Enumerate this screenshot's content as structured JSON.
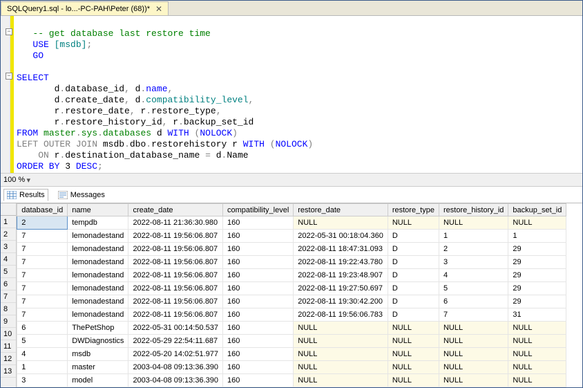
{
  "tab": {
    "title": "SQLQuery1.sql - lo...-PC-PAH\\Peter (68))*",
    "close": "✕"
  },
  "zoom": "100 %",
  "resultsTabs": {
    "results": "Results",
    "messages": "Messages"
  },
  "sql": {
    "comment": "-- get database last restore time",
    "use": "USE",
    "msdb": "[msdb]",
    "go": "GO",
    "select": "SELECT",
    "l1": "    d",
    "dot": ".",
    "database_id": "database_id",
    "cma": ", ",
    "d2": "d",
    "name": "name",
    "l2a": "    d",
    "create_date": "create_date",
    "compatibility_level": "compatibility_level",
    "l3a": "    r",
    "restore_date": "restore_date",
    "restore_type": "restore_type",
    "l4a": "    r",
    "restore_history_id": "restore_history_id",
    "backup_set_id": "backup_set_id",
    "r2": "r",
    "from": "FROM",
    "master": "master",
    "sys": "sys",
    "databases": "databases",
    "d": " d ",
    "with": "WITH",
    "nolock": "NOLOCK",
    "loj": "LEFT OUTER JOIN",
    "msdb2": "msdb",
    "dbo": "dbo",
    "rh": "restorehistory",
    "r": " r ",
    "on": "ON",
    "ddn": "destination_database_name",
    "eq": " = ",
    "dname": "Name",
    "orderby": "ORDER BY",
    "three": " 3 ",
    "desc": "DESC",
    "semi": ";",
    "op": "(",
    "cp": ")",
    "sp": " "
  },
  "columns": [
    "database_id",
    "name",
    "create_date",
    "compatibility_level",
    "restore_date",
    "restore_type",
    "restore_history_id",
    "backup_set_id"
  ],
  "rows": [
    {
      "n": 1,
      "database_id": "2",
      "name": "tempdb",
      "create_date": "2022-08-11 21:36:30.980",
      "compatibility_level": "160",
      "restore_date": "NULL",
      "restore_type": "NULL",
      "restore_history_id": "NULL",
      "backup_set_id": "NULL"
    },
    {
      "n": 2,
      "database_id": "7",
      "name": "lemonadestand",
      "create_date": "2022-08-11 19:56:06.807",
      "compatibility_level": "160",
      "restore_date": "2022-05-31 00:18:04.360",
      "restore_type": "D",
      "restore_history_id": "1",
      "backup_set_id": "1"
    },
    {
      "n": 3,
      "database_id": "7",
      "name": "lemonadestand",
      "create_date": "2022-08-11 19:56:06.807",
      "compatibility_level": "160",
      "restore_date": "2022-08-11 18:47:31.093",
      "restore_type": "D",
      "restore_history_id": "2",
      "backup_set_id": "29"
    },
    {
      "n": 4,
      "database_id": "7",
      "name": "lemonadestand",
      "create_date": "2022-08-11 19:56:06.807",
      "compatibility_level": "160",
      "restore_date": "2022-08-11 19:22:43.780",
      "restore_type": "D",
      "restore_history_id": "3",
      "backup_set_id": "29"
    },
    {
      "n": 5,
      "database_id": "7",
      "name": "lemonadestand",
      "create_date": "2022-08-11 19:56:06.807",
      "compatibility_level": "160",
      "restore_date": "2022-08-11 19:23:48.907",
      "restore_type": "D",
      "restore_history_id": "4",
      "backup_set_id": "29"
    },
    {
      "n": 6,
      "database_id": "7",
      "name": "lemonadestand",
      "create_date": "2022-08-11 19:56:06.807",
      "compatibility_level": "160",
      "restore_date": "2022-08-11 19:27:50.697",
      "restore_type": "D",
      "restore_history_id": "5",
      "backup_set_id": "29"
    },
    {
      "n": 7,
      "database_id": "7",
      "name": "lemonadestand",
      "create_date": "2022-08-11 19:56:06.807",
      "compatibility_level": "160",
      "restore_date": "2022-08-11 19:30:42.200",
      "restore_type": "D",
      "restore_history_id": "6",
      "backup_set_id": "29"
    },
    {
      "n": 8,
      "database_id": "7",
      "name": "lemonadestand",
      "create_date": "2022-08-11 19:56:06.807",
      "compatibility_level": "160",
      "restore_date": "2022-08-11 19:56:06.783",
      "restore_type": "D",
      "restore_history_id": "7",
      "backup_set_id": "31"
    },
    {
      "n": 9,
      "database_id": "6",
      "name": "ThePetShop",
      "create_date": "2022-05-31 00:14:50.537",
      "compatibility_level": "160",
      "restore_date": "NULL",
      "restore_type": "NULL",
      "restore_history_id": "NULL",
      "backup_set_id": "NULL"
    },
    {
      "n": 10,
      "database_id": "5",
      "name": "DWDiagnostics",
      "create_date": "2022-05-29 22:54:11.687",
      "compatibility_level": "160",
      "restore_date": "NULL",
      "restore_type": "NULL",
      "restore_history_id": "NULL",
      "backup_set_id": "NULL"
    },
    {
      "n": 11,
      "database_id": "4",
      "name": "msdb",
      "create_date": "2022-05-20 14:02:51.977",
      "compatibility_level": "160",
      "restore_date": "NULL",
      "restore_type": "NULL",
      "restore_history_id": "NULL",
      "backup_set_id": "NULL"
    },
    {
      "n": 12,
      "database_id": "1",
      "name": "master",
      "create_date": "2003-04-08 09:13:36.390",
      "compatibility_level": "160",
      "restore_date": "NULL",
      "restore_type": "NULL",
      "restore_history_id": "NULL",
      "backup_set_id": "NULL"
    },
    {
      "n": 13,
      "database_id": "3",
      "name": "model",
      "create_date": "2003-04-08 09:13:36.390",
      "compatibility_level": "160",
      "restore_date": "NULL",
      "restore_type": "NULL",
      "restore_history_id": "NULL",
      "backup_set_id": "NULL"
    }
  ]
}
